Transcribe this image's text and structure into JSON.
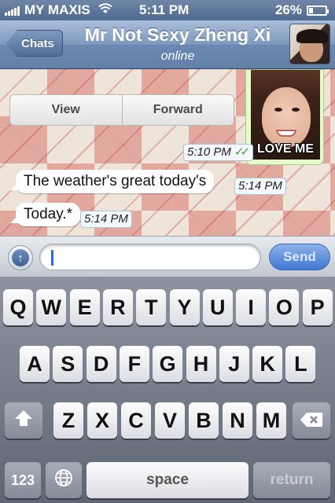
{
  "status_bar": {
    "carrier": "MY MAXIS",
    "time": "5:11 PM",
    "battery": "26%",
    "battery_level": 0.26,
    "icons": [
      "signal-icon",
      "wifi-icon",
      "battery-icon"
    ]
  },
  "nav": {
    "back_label": "Chats",
    "title": "Mr Not Sexy Zheng Xi",
    "subtitle": "online"
  },
  "chat": {
    "media_actions": {
      "view": "View",
      "forward": "Forward"
    },
    "photo": {
      "caption": "LOVE ME",
      "timestamp": "5:10 PM",
      "status_icon": "double-check-icon"
    },
    "messages": [
      {
        "text": "The weather's great today's",
        "timestamp": "5:14 PM"
      },
      {
        "text": "Today.*",
        "timestamp": "5:14 PM"
      }
    ]
  },
  "input_bar": {
    "attach_icon": "upload-arrow-icon",
    "text_value": "",
    "send_label": "Send"
  },
  "keyboard": {
    "row1": [
      "Q",
      "W",
      "E",
      "R",
      "T",
      "Y",
      "U",
      "I",
      "O",
      "P"
    ],
    "row2": [
      "A",
      "S",
      "D",
      "F",
      "G",
      "H",
      "J",
      "K",
      "L"
    ],
    "row3": [
      "Z",
      "X",
      "C",
      "V",
      "B",
      "N",
      "M"
    ],
    "shift_icon": "shift-arrow-icon",
    "delete_icon": "backspace-icon",
    "numbers_label": "123",
    "globe_icon": "globe-icon",
    "space_label": "space",
    "return_label": "return"
  },
  "colors": {
    "nav_bar": "#6b88b0",
    "outgoing_bubble": "#e2ffc8",
    "send_button": "#3f78d2",
    "read_check": "#3ea43e"
  }
}
